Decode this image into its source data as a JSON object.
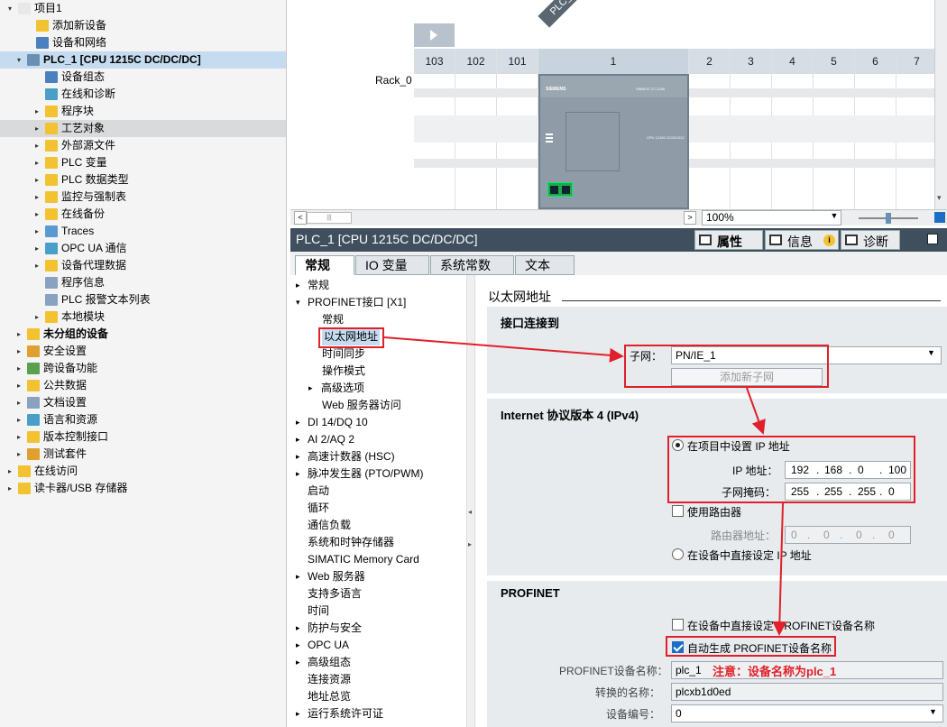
{
  "tree": {
    "items": [
      {
        "label": "项目1",
        "indent": 0,
        "exp": "▾",
        "icon": "#e8e8e8"
      },
      {
        "label": "添加新设备",
        "indent": 2,
        "exp": "",
        "icon": "#f2c230"
      },
      {
        "label": "设备和网络",
        "indent": 2,
        "exp": "",
        "icon": "#4a7fc0"
      },
      {
        "label": "PLC_1 [CPU 1215C DC/DC/DC]",
        "indent": 1,
        "exp": "▾",
        "icon": "#6a8fb5",
        "sel": true,
        "bold": true
      },
      {
        "label": "设备组态",
        "indent": 3,
        "exp": "",
        "icon": "#4a7fc0"
      },
      {
        "label": "在线和诊断",
        "indent": 3,
        "exp": "",
        "icon": "#4a9fc8"
      },
      {
        "label": "程序块",
        "indent": 3,
        "exp": "▸",
        "icon": "#f2c230"
      },
      {
        "label": "工艺对象",
        "indent": 3,
        "exp": "▸",
        "icon": "#f2c230",
        "hl": true
      },
      {
        "label": "外部源文件",
        "indent": 3,
        "exp": "▸",
        "icon": "#f2c230"
      },
      {
        "label": "PLC 变量",
        "indent": 3,
        "exp": "▸",
        "icon": "#f2c230"
      },
      {
        "label": "PLC 数据类型",
        "indent": 3,
        "exp": "▸",
        "icon": "#f2c230"
      },
      {
        "label": "监控与强制表",
        "indent": 3,
        "exp": "▸",
        "icon": "#f2c230"
      },
      {
        "label": "在线备份",
        "indent": 3,
        "exp": "▸",
        "icon": "#f2c230"
      },
      {
        "label": "Traces",
        "indent": 3,
        "exp": "▸",
        "icon": "#5a9ad0"
      },
      {
        "label": "OPC UA 通信",
        "indent": 3,
        "exp": "▸",
        "icon": "#4a9fc8"
      },
      {
        "label": "设备代理数据",
        "indent": 3,
        "exp": "▸",
        "icon": "#f2c230"
      },
      {
        "label": "程序信息",
        "indent": 3,
        "exp": "",
        "icon": "#8aa2c0"
      },
      {
        "label": "PLC 报警文本列表",
        "indent": 3,
        "exp": "",
        "icon": "#8aa2c0"
      },
      {
        "label": "本地模块",
        "indent": 3,
        "exp": "▸",
        "icon": "#f2c230"
      },
      {
        "label": "未分组的设备",
        "indent": 1,
        "exp": "▸",
        "icon": "#f2c230",
        "bold": true
      },
      {
        "label": "安全设置",
        "indent": 1,
        "exp": "▸",
        "icon": "#e0a030"
      },
      {
        "label": "跨设备功能",
        "indent": 1,
        "exp": "▸",
        "icon": "#5aa050"
      },
      {
        "label": "公共数据",
        "indent": 1,
        "exp": "▸",
        "icon": "#f2c230"
      },
      {
        "label": "文档设置",
        "indent": 1,
        "exp": "▸",
        "icon": "#8aa2c0"
      },
      {
        "label": "语言和资源",
        "indent": 1,
        "exp": "▸",
        "icon": "#4a9fc8"
      },
      {
        "label": "版本控制接口",
        "indent": 1,
        "exp": "▸",
        "icon": "#f2c230"
      },
      {
        "label": "测试套件",
        "indent": 1,
        "exp": "▸",
        "icon": "#e0a030"
      },
      {
        "label": "在线访问",
        "indent": 0,
        "exp": "▸",
        "icon": "#f2c230"
      },
      {
        "label": "读卡器/USB 存储器",
        "indent": 0,
        "exp": "▸",
        "icon": "#f2c230"
      }
    ]
  },
  "rack": {
    "tag": "PLC_1",
    "name": "Rack_0",
    "slots": [
      "103",
      "102",
      "101",
      "1",
      "2",
      "3",
      "4",
      "5",
      "6",
      "7"
    ],
    "cpu_brand": "SIEMENS",
    "cpu_model": "SIMATIC S7-1200",
    "cpu_type": "CPU 1215C DC/DC/DC"
  },
  "hscroll": {
    "zoom": "100%"
  },
  "properties": {
    "title": "PLC_1 [CPU 1215C DC/DC/DC]",
    "tab_props": "属性",
    "tab_info": "信息",
    "tab_diag": "诊断",
    "tabs": [
      "常规",
      "IO 变量",
      "系统常数",
      "文本"
    ]
  },
  "nav": {
    "items": [
      {
        "label": "常规",
        "indent": 0,
        "exp": "▸"
      },
      {
        "label": "PROFINET接口 [X1]",
        "indent": 0,
        "exp": "▾"
      },
      {
        "label": "常规",
        "indent": 2,
        "exp": ""
      },
      {
        "label": "以太网地址",
        "indent": 2,
        "exp": "",
        "sel": true
      },
      {
        "label": "时间同步",
        "indent": 2,
        "exp": ""
      },
      {
        "label": "操作模式",
        "indent": 2,
        "exp": ""
      },
      {
        "label": "高级选项",
        "indent": 1,
        "exp": "▸"
      },
      {
        "label": "Web 服务器访问",
        "indent": 2,
        "exp": ""
      },
      {
        "label": "DI 14/DQ 10",
        "indent": 0,
        "exp": "▸"
      },
      {
        "label": "AI 2/AQ 2",
        "indent": 0,
        "exp": "▸"
      },
      {
        "label": "高速计数器 (HSC)",
        "indent": 0,
        "exp": "▸"
      },
      {
        "label": "脉冲发生器 (PTO/PWM)",
        "indent": 0,
        "exp": "▸"
      },
      {
        "label": "启动",
        "indent": 1,
        "exp": ""
      },
      {
        "label": "循环",
        "indent": 1,
        "exp": ""
      },
      {
        "label": "通信负载",
        "indent": 1,
        "exp": ""
      },
      {
        "label": "系统和时钟存储器",
        "indent": 1,
        "exp": ""
      },
      {
        "label": "SIMATIC Memory Card",
        "indent": 1,
        "exp": ""
      },
      {
        "label": "Web 服务器",
        "indent": 0,
        "exp": "▸"
      },
      {
        "label": "支持多语言",
        "indent": 1,
        "exp": ""
      },
      {
        "label": "时间",
        "indent": 1,
        "exp": ""
      },
      {
        "label": "防护与安全",
        "indent": 0,
        "exp": "▸"
      },
      {
        "label": "OPC UA",
        "indent": 0,
        "exp": "▸"
      },
      {
        "label": "高级组态",
        "indent": 0,
        "exp": "▸"
      },
      {
        "label": "连接资源",
        "indent": 1,
        "exp": ""
      },
      {
        "label": "地址总览",
        "indent": 1,
        "exp": ""
      },
      {
        "label": "运行系统许可证",
        "indent": 0,
        "exp": "▸"
      }
    ]
  },
  "content": {
    "title": "以太网地址",
    "iface_title": "接口连接到",
    "subnet_label": "子网：",
    "subnet_value": "PN/IE_1",
    "add_subnet": "添加新子网",
    "ipv4_title": "Internet 协议版本 4 (IPv4)",
    "opt_set_ip": "在项目中设置 IP 地址",
    "ip_label": "IP 地址：",
    "ip_value": [
      "192",
      "168",
      "0",
      "100"
    ],
    "mask_label": "子网掩码：",
    "mask_value": [
      "255",
      "255",
      "255",
      "0"
    ],
    "use_router": "使用路由器",
    "router_label": "路由器地址：",
    "router_value": [
      "0",
      "0",
      "0",
      "0"
    ],
    "opt_direct_ip": "在设备中直接设定 IP 地址",
    "profinet_title": "PROFINET",
    "pn_direct": "在设备中直接设定 PROFINET设备名称",
    "pn_auto": "自动生成 PROFINET设备名称",
    "pn_name_label": "PROFINET设备名称：",
    "pn_name_value": "plc_1",
    "note": "注意：设备名称为plc_1",
    "conv_label": "转换的名称：",
    "conv_value": "plcxb1d0ed",
    "devno_label": "设备编号：",
    "devno_value": "0"
  },
  "colors": {
    "accent_red": "#e0202a",
    "nav_bg": "#3f4f5e",
    "selection": "#c5dbef"
  }
}
